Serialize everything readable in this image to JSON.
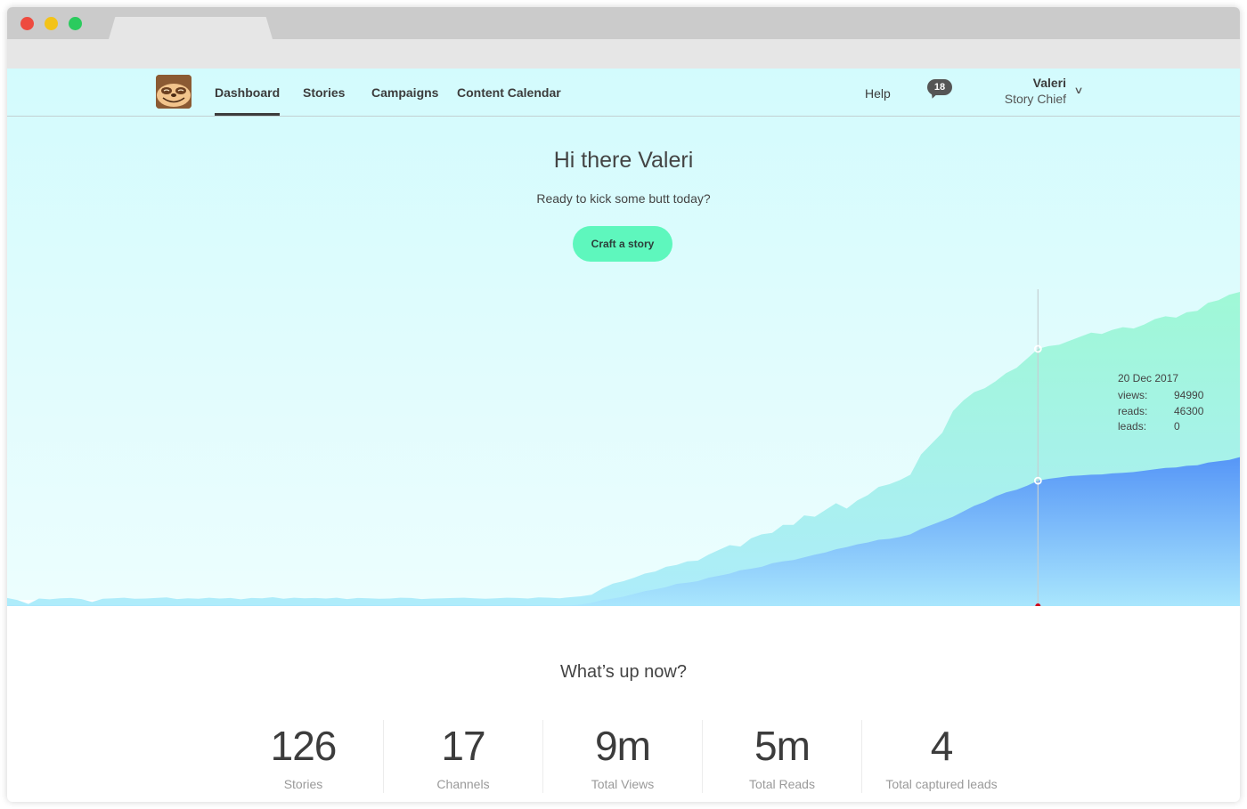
{
  "window": {
    "controls": [
      "close",
      "minimize",
      "maximize"
    ]
  },
  "nav": {
    "logo": "sloth-logo",
    "items": [
      {
        "label": "Dashboard",
        "active": true
      },
      {
        "label": "Stories",
        "active": false
      },
      {
        "label": "Campaigns",
        "active": false
      },
      {
        "label": "Content Calendar",
        "active": false
      }
    ],
    "help_label": "Help",
    "notifications_count": "18",
    "user": {
      "name": "Valeri",
      "role": "Story Chief"
    }
  },
  "hero": {
    "greeting": "Hi there Valeri",
    "subtitle": "Ready to kick some butt today?",
    "cta_label": "Craft a story"
  },
  "chart_data": {
    "type": "area",
    "title": "",
    "xlabel": "",
    "ylabel": "",
    "ylim": [
      0,
      117000
    ],
    "grid": false,
    "legend": "none",
    "colors": {
      "views": "#9ff7d8",
      "reads": "#5b9ef8"
    },
    "series": [
      {
        "name": "views",
        "values": [
          3000,
          2200,
          800,
          2800,
          2500,
          2900,
          3000,
          2600,
          1500,
          2700,
          2900,
          3100,
          2700,
          2800,
          3000,
          3200,
          2600,
          2900,
          2700,
          3100,
          2800,
          3000,
          2500,
          3000,
          2900,
          3300,
          2700,
          3100,
          2900,
          3000,
          2800,
          3100,
          2600,
          3000,
          2900,
          2700,
          2800,
          3100,
          3000,
          2600,
          2800,
          2900,
          3000,
          3100,
          2900,
          2700,
          2900,
          3100,
          3000,
          2800,
          3200,
          3100,
          2900,
          3300,
          3600,
          4200,
          6500,
          8300,
          9200,
          10500,
          12000,
          12800,
          14500,
          15200,
          16500,
          16800,
          19000,
          20800,
          22500,
          22000,
          25000,
          26500,
          27000,
          30000,
          30000,
          33500,
          33000,
          35500,
          38000,
          36000,
          39000,
          41000,
          44000,
          45000,
          46500,
          48500,
          56000,
          60000,
          64000,
          72000,
          76000,
          79000,
          80500,
          83000,
          86000,
          88000,
          91500,
          94990,
          96000,
          96500,
          98000,
          99500,
          101000,
          100500,
          102000,
          103000,
          102500,
          104000,
          106000,
          107000,
          106500,
          108500,
          109000,
          112000,
          113000,
          115000,
          116000
        ]
      },
      {
        "name": "reads",
        "values": [
          200,
          180,
          150,
          200,
          190,
          200,
          210,
          200,
          180,
          200,
          210,
          220,
          200,
          210,
          220,
          230,
          200,
          210,
          200,
          220,
          210,
          220,
          200,
          220,
          210,
          230,
          200,
          220,
          210,
          220,
          200,
          220,
          200,
          220,
          210,
          200,
          210,
          220,
          220,
          200,
          210,
          220,
          220,
          230,
          220,
          200,
          210,
          230,
          220,
          210,
          230,
          230,
          220,
          240,
          600,
          1200,
          2200,
          2800,
          3500,
          4500,
          5500,
          6200,
          7000,
          8200,
          8600,
          9200,
          10500,
          11200,
          12000,
          13200,
          13800,
          14500,
          15800,
          16500,
          17000,
          18000,
          19000,
          19800,
          21000,
          21800,
          22800,
          23500,
          24500,
          24800,
          25500,
          26500,
          28500,
          30000,
          31500,
          33000,
          35000,
          37000,
          38500,
          40500,
          42000,
          43000,
          44500,
          46300,
          47000,
          47500,
          48000,
          48200,
          48500,
          48600,
          49000,
          49200,
          49500,
          50000,
          50500,
          51000,
          51200,
          51800,
          52000,
          53000,
          53500,
          54000,
          55000
        ]
      }
    ],
    "tooltip": {
      "date": "20 Dec 2017",
      "views": 94990,
      "reads": 46300,
      "leads": 0,
      "index": 97
    }
  },
  "tooltip_labels": {
    "date": "20 Dec 2017",
    "views_label": "views:",
    "views": "94990",
    "reads_label": "reads:",
    "reads": "46300",
    "leads_label": "leads:",
    "leads": "0"
  },
  "stats": {
    "title": "What’s up now?",
    "items": [
      {
        "value": "126",
        "label": "Stories"
      },
      {
        "value": "17",
        "label": "Channels"
      },
      {
        "value": "9m",
        "label": "Total Views"
      },
      {
        "value": "5m",
        "label": "Total Reads"
      },
      {
        "value": "4",
        "label": "Total captured leads"
      }
    ]
  }
}
